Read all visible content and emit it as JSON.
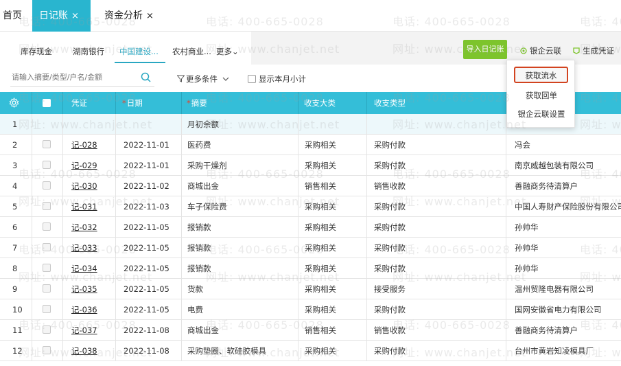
{
  "top_tabs": {
    "home": "首页",
    "active_label": "日记账",
    "active_close": "×",
    "analysis_label": "资金分析",
    "analysis_close": "×"
  },
  "bank_tabs": [
    "库存现金",
    "湖南银行",
    "中国建设...",
    "农村商业...",
    "更多"
  ],
  "bank_more_caret": "⌄",
  "actions": {
    "import_label": "导入日记账",
    "bank_cloud_label": "银企云联",
    "generate_voucher_label": "生成凭证"
  },
  "filter": {
    "search_placeholder": "请输入摘要/类型/户名/金额",
    "more_conditions_label": "更多条件",
    "monthly_subtotal_label": "显示本月小计"
  },
  "table": {
    "headers": {
      "voucher": "凭证",
      "date": "日期",
      "summary": "摘要",
      "category": "收支大类",
      "type": "收支类型"
    },
    "rows": [
      {
        "no": "1",
        "voucher": "",
        "date": "",
        "summary": "月初余额",
        "category": "",
        "type": "",
        "party": ""
      },
      {
        "no": "2",
        "voucher": "记-028",
        "date": "2022-11-01",
        "summary": "医药费",
        "category": "采购相关",
        "type": "采购付款",
        "party": "冯会"
      },
      {
        "no": "3",
        "voucher": "记-029",
        "date": "2022-11-01",
        "summary": "采购干燥剂",
        "category": "采购相关",
        "type": "采购付款",
        "party": "南京威越包装有限公司"
      },
      {
        "no": "4",
        "voucher": "记-030",
        "date": "2022-11-02",
        "summary": "商城出金",
        "category": "销售相关",
        "type": "销售收款",
        "party": "善融商务待清算户"
      },
      {
        "no": "5",
        "voucher": "记-031",
        "date": "2022-11-03",
        "summary": "车子保险费",
        "category": "采购相关",
        "type": "采购付款",
        "party": "中国人寿财产保险股份有限公司"
      },
      {
        "no": "6",
        "voucher": "记-032",
        "date": "2022-11-05",
        "summary": "报销款",
        "category": "采购相关",
        "type": "采购付款",
        "party": "孙帅华"
      },
      {
        "no": "7",
        "voucher": "记-033",
        "date": "2022-11-05",
        "summary": "报销款",
        "category": "采购相关",
        "type": "采购付款",
        "party": "孙帅华"
      },
      {
        "no": "8",
        "voucher": "记-034",
        "date": "2022-11-05",
        "summary": "报销款",
        "category": "采购相关",
        "type": "采购付款",
        "party": "孙帅华"
      },
      {
        "no": "9",
        "voucher": "记-035",
        "date": "2022-11-05",
        "summary": "货款",
        "category": "采购相关",
        "type": "接受服务",
        "party": "温州贸隆电器有限公司"
      },
      {
        "no": "10",
        "voucher": "记-036",
        "date": "2022-11-05",
        "summary": "电费",
        "category": "采购相关",
        "type": "采购付款",
        "party": "国网安徽省电力有限公司"
      },
      {
        "no": "11",
        "voucher": "记-037",
        "date": "2022-11-08",
        "summary": "商城出金",
        "category": "销售相关",
        "type": "销售收款",
        "party": "善融商务待清算户"
      },
      {
        "no": "12",
        "voucher": "记-038",
        "date": "2022-11-08",
        "summary": "采购垫圈、软硅胶模具",
        "category": "采购相关",
        "type": "采购付款",
        "party": "台州市黄岩知凌模具厂"
      }
    ]
  },
  "dropdown": {
    "items": [
      "获取流水",
      "获取回单",
      "银企云联设置"
    ]
  },
  "watermark": {
    "phone": "电话: 400-665-0028",
    "site": "网址: www.chanjet.net"
  },
  "colors": {
    "header_bg": "#34bed8",
    "active_tab_bg": "#29b5cf",
    "import_btn": "#7dc42c",
    "highlight_border": "#d2431f"
  }
}
